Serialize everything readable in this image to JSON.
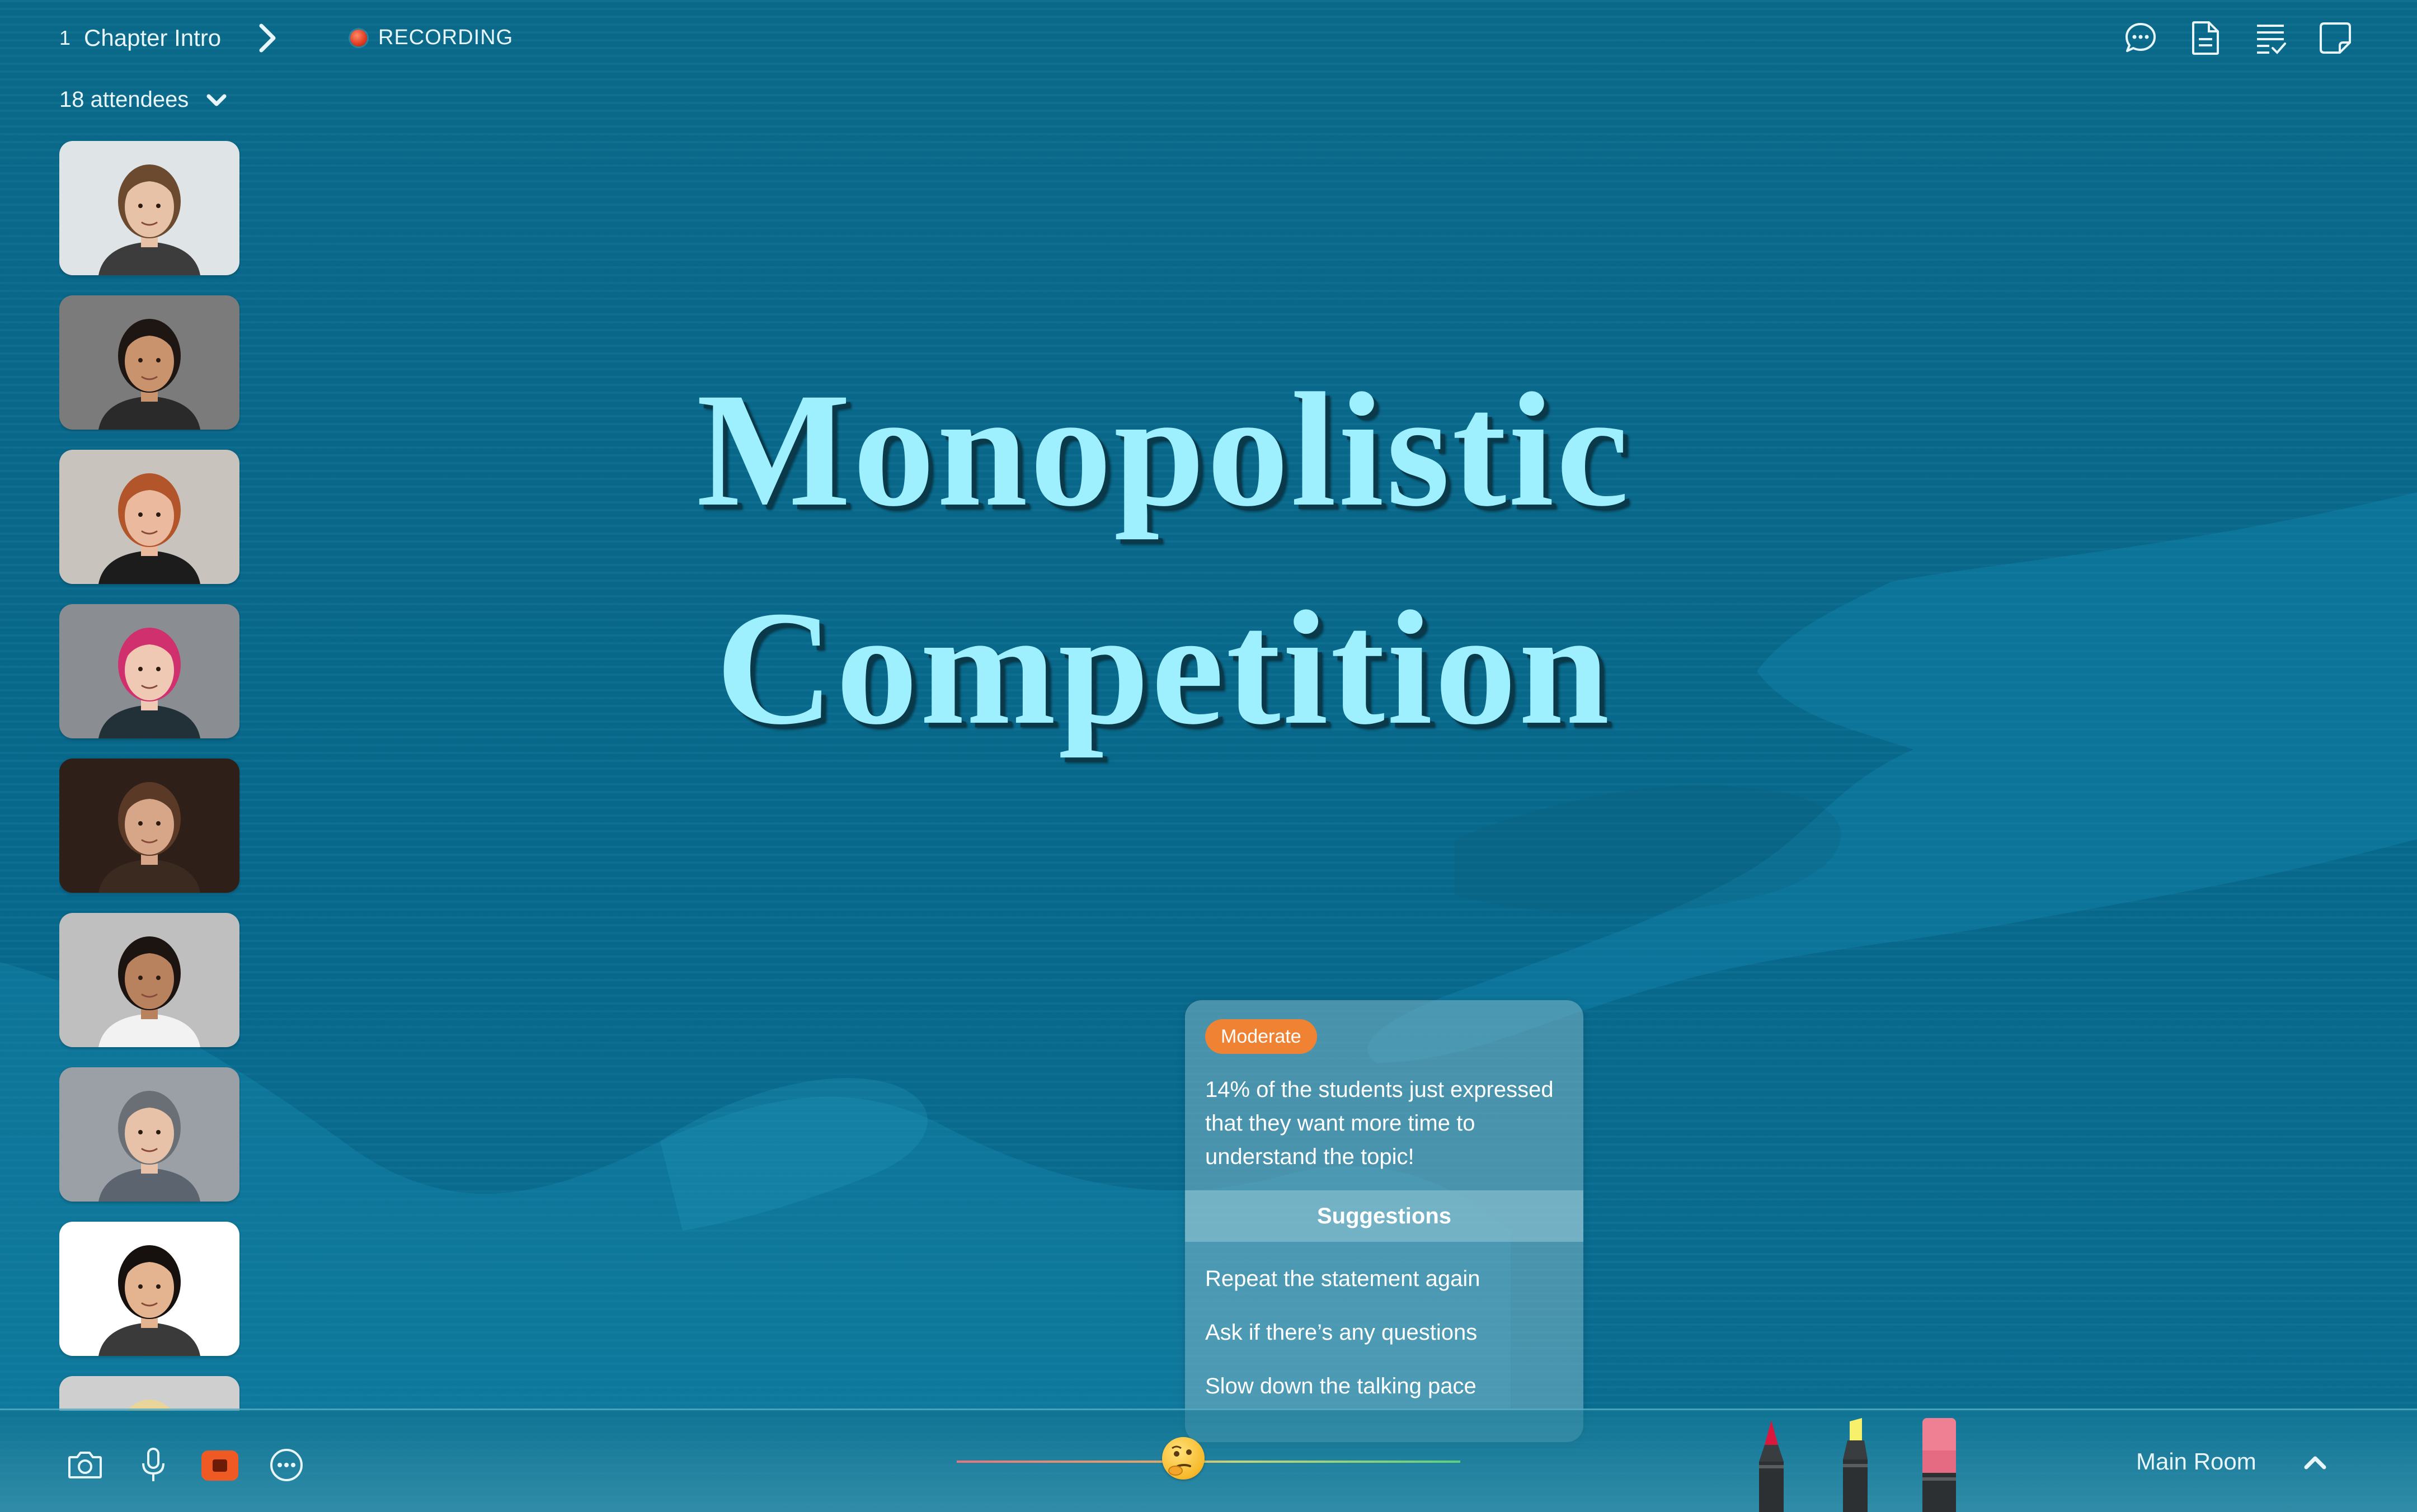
{
  "header": {
    "chapter_number": "1",
    "chapter_title": "Chapter Intro",
    "recording_label": "RECORDING",
    "attendees_label": "18 attendees"
  },
  "top_icons": [
    "chat-bubble-icon",
    "document-icon",
    "checklist-icon",
    "sticky-note-icon"
  ],
  "participants": [
    {
      "name": "participant-1",
      "skin": "#e8c2a6",
      "hair": "#6b4a30",
      "bg": "#dfe5e6",
      "shirt": "#3c3c3c"
    },
    {
      "name": "participant-2",
      "skin": "#c9936d",
      "hair": "#1e1612",
      "bg": "#7b7b7b",
      "shirt": "#2a2a2a"
    },
    {
      "name": "participant-3",
      "skin": "#eab99e",
      "hair": "#b2552b",
      "bg": "#c8c3bd",
      "shirt": "#1c1c1c"
    },
    {
      "name": "participant-4",
      "skin": "#f0c9b5",
      "hair": "#d1306e",
      "bg": "#8a8d92",
      "shirt": "#223038"
    },
    {
      "name": "participant-5",
      "skin": "#d7a688",
      "hair": "#5a3a26",
      "bg": "#2e2018",
      "shirt": "#3a2a20"
    },
    {
      "name": "participant-6",
      "skin": "#b9825f",
      "hair": "#1c1410",
      "bg": "#bfbfbf",
      "shirt": "#f2f2f2"
    },
    {
      "name": "participant-7",
      "skin": "#e7c1a8",
      "hair": "#6a6f76",
      "bg": "#9aa0a5",
      "shirt": "#5c6470"
    },
    {
      "name": "participant-8",
      "skin": "#e3b48f",
      "hair": "#16110e",
      "bg": "#ffffff",
      "shirt": "#3a3a3a"
    },
    {
      "name": "participant-9",
      "skin": "#f1d0b8",
      "hair": "#e9d59a",
      "bg": "#cfcfcf",
      "shirt": "#cfcfcf"
    }
  ],
  "slide": {
    "title_line1": "Monopolistic",
    "title_line2": "Competition"
  },
  "insight_card": {
    "badge": "Moderate",
    "message": "14% of the students just expressed that they want more time to understand the topic!",
    "suggestions_heading": "Suggestions",
    "suggestions": [
      "Repeat the statement again",
      "Ask if there’s any questions",
      "Slow down the talking pace"
    ]
  },
  "bottom_bar": {
    "controls": [
      "camera-icon",
      "microphone-icon",
      "stop-recording-button",
      "more-options-icon"
    ],
    "mood_emoji": "thinking-face-emoji",
    "mood_level": 0.45,
    "pens": [
      {
        "name": "red-pen",
        "tip": "#d8183c"
      },
      {
        "name": "yellow-highlighter",
        "tip": "#f6f06a"
      },
      {
        "name": "pink-eraser",
        "tip": "#ef7f93"
      }
    ],
    "room_label": "Main Room"
  },
  "colors": {
    "background": "#086a8e",
    "title": "#9ff0ff",
    "badge": "#f08333",
    "record": "#ef5a24"
  }
}
